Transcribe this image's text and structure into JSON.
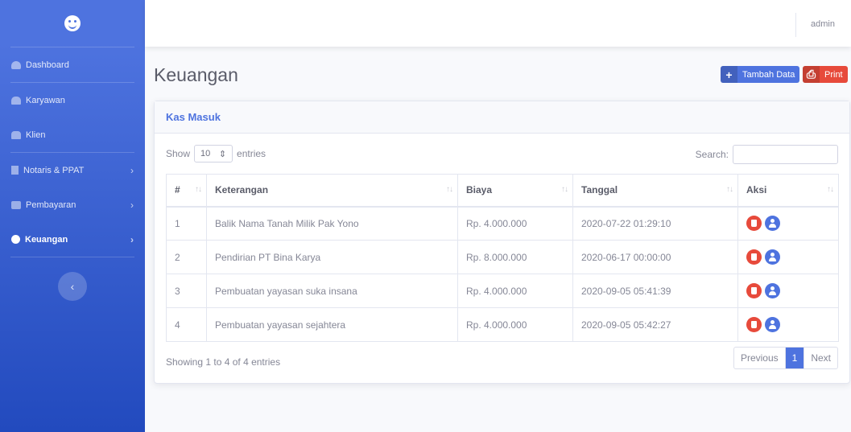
{
  "sidebar": {
    "brand_icon": "laughing-face-icon",
    "items": [
      {
        "label": "Dashboard",
        "icon": "tachometer-icon"
      },
      {
        "label": "Karyawan",
        "icon": "user-icon"
      },
      {
        "label": "Klien",
        "icon": "user-plus-icon"
      },
      {
        "label": "Notaris & PPAT",
        "icon": "document-icon",
        "chevron": "›"
      },
      {
        "label": "Pembayaran",
        "icon": "credit-card-icon",
        "chevron": "›"
      },
      {
        "label": "Keuangan",
        "icon": "money-icon",
        "chevron": "›",
        "active": true
      }
    ],
    "toggle": "‹"
  },
  "topbar": {
    "user": "admin"
  },
  "page": {
    "title": "Keuangan"
  },
  "toolbar": {
    "add_icon": "+",
    "add_label": "Tambah Data",
    "print_icon": "⎙",
    "print_label": "Print"
  },
  "card": {
    "title": "Kas Masuk",
    "length": {
      "prefix": "Show",
      "value": "10",
      "suffix": "entries"
    },
    "search_label": "Search:",
    "search_value": "",
    "columns": [
      "#",
      "Keterangan",
      "Biaya",
      "Tanggal",
      "Aksi"
    ],
    "rows": [
      {
        "no": "1",
        "keterangan": "Balik Nama Tanah Milik Pak Yono",
        "biaya": "Rp. 4.000.000",
        "tanggal": "2020-07-22 01:29:10"
      },
      {
        "no": "2",
        "keterangan": "Pendirian PT Bina Karya",
        "biaya": "Rp. 8.000.000",
        "tanggal": "2020-06-17 00:00:00"
      },
      {
        "no": "3",
        "keterangan": "Pembuatan yayasan suka insana",
        "biaya": "Rp. 4.000.000",
        "tanggal": "2020-09-05 05:41:39"
      },
      {
        "no": "4",
        "keterangan": "Pembuatan yayasan sejahtera",
        "biaya": "Rp. 4.000.000",
        "tanggal": "2020-09-05 05:42:27"
      }
    ],
    "info": "Showing 1 to 4 of 4 entries",
    "pagination": {
      "previous": "Previous",
      "current": "1",
      "next": "Next"
    }
  },
  "colors": {
    "primary": "#4e73df",
    "danger": "#e74a3b"
  }
}
